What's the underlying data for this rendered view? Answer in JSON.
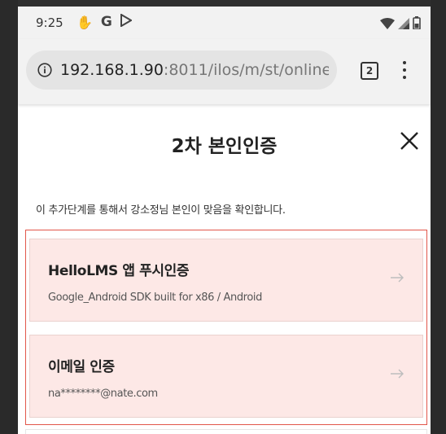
{
  "status_bar": {
    "time": "9:25",
    "left_icons": [
      "signal-hand-icon",
      "google-icon",
      "play-store-icon"
    ],
    "right_icons": [
      "wifi-icon",
      "cell-signal-icon",
      "battery-icon"
    ]
  },
  "browser": {
    "url_host": "192.168.1.90",
    "url_path": ":8011/ilos/m/st/online_",
    "tab_count": "2"
  },
  "page": {
    "title": "2차 본인인증",
    "description": "이 추가단계를 통해서 강소정님 본인이 맞음을 확인합니다.",
    "methods": [
      {
        "title": "HelloLMS 앱 푸시인증",
        "subtitle": "Google_Android SDK built for x86 / Android"
      },
      {
        "title": "이메일 인증",
        "subtitle": "na********@nate.com"
      }
    ]
  },
  "colors": {
    "card_background": "#fde8e6",
    "selected_border": "#e2564a",
    "status_bar": "#f2f2f2"
  }
}
